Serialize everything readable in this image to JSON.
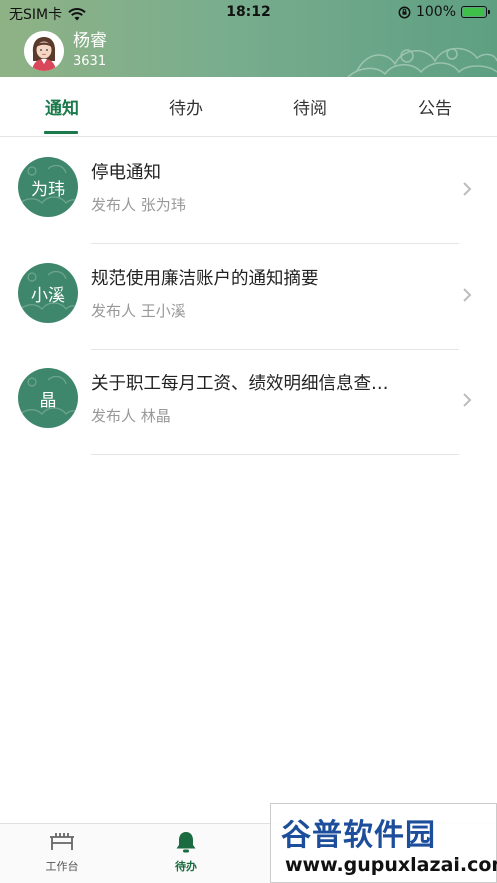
{
  "status_bar": {
    "carrier": "无SIM卡",
    "time": "18:12",
    "battery": "100%"
  },
  "user": {
    "name": "杨睿",
    "id": "3631"
  },
  "tabs": [
    {
      "label": "通知",
      "active": true
    },
    {
      "label": "待办",
      "active": false
    },
    {
      "label": "待阅",
      "active": false
    },
    {
      "label": "公告",
      "active": false
    }
  ],
  "notices": [
    {
      "badge": "为玮",
      "title": "停电通知",
      "publisher": "发布人 张为玮"
    },
    {
      "badge": "小溪",
      "title": "规范使用廉洁账户的通知摘要",
      "publisher": "发布人 王小溪"
    },
    {
      "badge": "晶",
      "title": "关于职工每月工资、绩效明细信息查…",
      "publisher": "发布人 林晶"
    }
  ],
  "bottom_nav": [
    {
      "label": "工作台",
      "icon": "workbench-icon",
      "active": false
    },
    {
      "label": "待办",
      "icon": "bell-icon",
      "active": true
    }
  ],
  "watermark": {
    "title": "谷普软件园",
    "url": "www.gupuxlazai.com"
  },
  "colors": {
    "accent": "#1a7a4c",
    "badge": "#3e876c",
    "header_start": "#8fb285",
    "header_end": "#5e9f82"
  }
}
